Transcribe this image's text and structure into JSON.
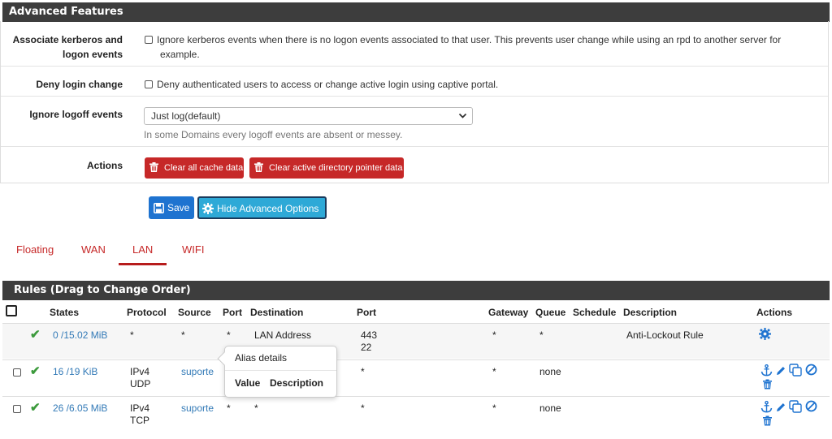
{
  "advanced": {
    "title": "Advanced Features",
    "kerberos": {
      "label_line1": "Associate kerberos and",
      "label_line2": "logon events",
      "text_line1": "Ignore kerberos events when there is no logon events associated to that user. This prevents user change while using an rpd to another server for",
      "text_line2": "example."
    },
    "deny": {
      "label": "Deny login change",
      "text": "Deny authenticated users to access or change active login using captive portal."
    },
    "logoff": {
      "label": "Ignore logoff events",
      "selected": "Just log(default)",
      "help": "In some Domains every logoff events are absent or messey."
    },
    "actions": {
      "label": "Actions",
      "clear_cache": "Clear all cache data",
      "clear_ad": "Clear active directory pointer data"
    }
  },
  "buttons": {
    "save": "Save",
    "hide_advanced": "Hide Advanced Options"
  },
  "tabs": [
    {
      "label": "Floating",
      "active": false
    },
    {
      "label": "WAN",
      "active": false
    },
    {
      "label": "LAN",
      "active": true
    },
    {
      "label": "WIFI",
      "active": false
    }
  ],
  "rules": {
    "title": "Rules (Drag to Change Order)",
    "columns": {
      "states": "States",
      "protocol": "Protocol",
      "source": "Source",
      "port": "Port",
      "destination": "Destination",
      "dport": "Port",
      "gateway": "Gateway",
      "queue": "Queue",
      "schedule": "Schedule",
      "description": "Description",
      "actions": "Actions"
    },
    "rows": [
      {
        "states": "0 /15.02 MiB",
        "protocol": "*",
        "protocol2": "",
        "source": "*",
        "port": "*",
        "destination": "LAN Address",
        "dport": "443",
        "dport2": "22",
        "gateway": "*",
        "queue": "*",
        "schedule": "",
        "description": "Anti-Lockout Rule"
      },
      {
        "states": "16 /19 KiB",
        "protocol": "IPv4",
        "protocol2": "UDP",
        "source": "suporte",
        "port": "*",
        "destination": "*",
        "dport": "*",
        "dport2": "",
        "gateway": "*",
        "queue": "none",
        "schedule": "",
        "description": ""
      },
      {
        "states": "26 /6.05 MiB",
        "protocol": "IPv4",
        "protocol2": "TCP",
        "source": "suporte",
        "port": "*",
        "destination": "*",
        "dport": "*",
        "dport2": "",
        "gateway": "*",
        "queue": "none",
        "schedule": "",
        "description": ""
      }
    ]
  },
  "popover": {
    "title": "Alias details",
    "col_value": "Value",
    "col_description": "Description"
  },
  "icons": {
    "trash": "trash-icon",
    "save": "floppy-disk-icon",
    "gear": "gear-icon",
    "check": "check-icon",
    "anchor": "anchor-icon",
    "pencil": "pencil-icon",
    "copy": "copy-icon",
    "ban": "ban-icon"
  },
  "colors": {
    "header_bg": "#3d3d3d",
    "danger": "#c62828",
    "primary": "#1e73d0",
    "info": "#2ea9d7",
    "link": "#337ab7",
    "success": "#3c9a3c"
  }
}
